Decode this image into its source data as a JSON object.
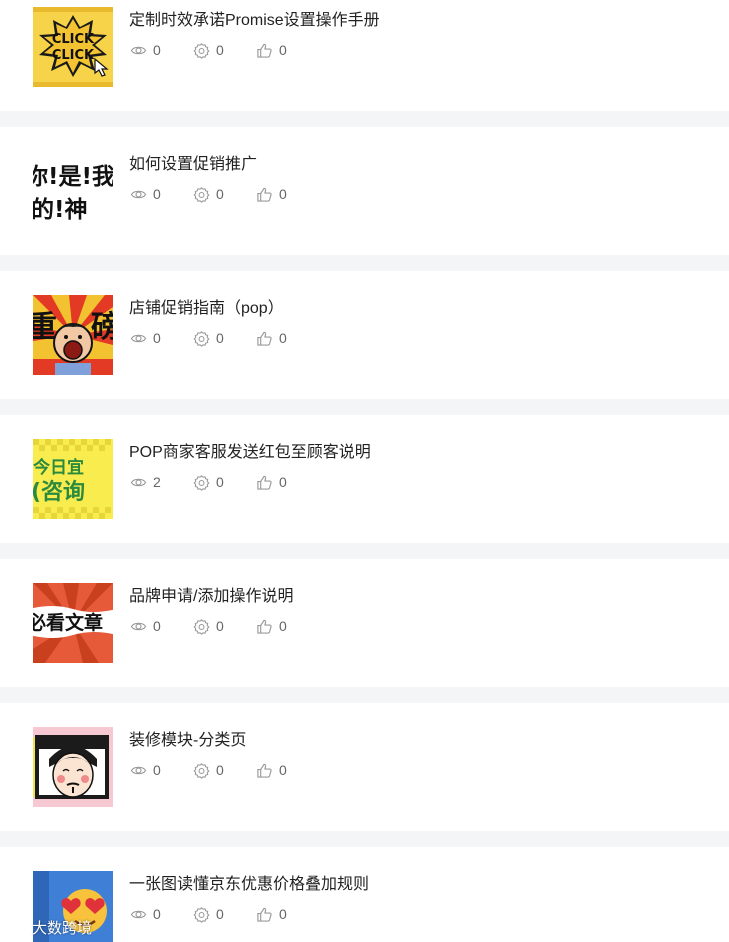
{
  "articles": [
    {
      "title": "定制时效承诺Promise设置操作手册",
      "views": "0",
      "shares": "0",
      "likes": "0",
      "thumb_icon": "click-click-comic-icon",
      "thumb_text": [
        "CLICK",
        "CLICK"
      ]
    },
    {
      "title": "如何设置促销推广",
      "views": "0",
      "shares": "0",
      "likes": "0",
      "thumb_icon": "comic-text-icon",
      "thumb_text": [
        "你!是!我",
        "的!神"
      ]
    },
    {
      "title": "店铺促销指南（pop）",
      "views": "0",
      "shares": "0",
      "likes": "0",
      "thumb_icon": "screaming-cartoon-icon",
      "thumb_text": [
        "重",
        "磅"
      ]
    },
    {
      "title": "POP商家客服发送红包至顾客说明",
      "views": "2",
      "shares": "0",
      "likes": "0",
      "thumb_icon": "today-consult-icon",
      "thumb_text": [
        "今日宜",
        "(咨询"
      ]
    },
    {
      "title": "品牌申请/添加操作说明",
      "views": "0",
      "shares": "0",
      "likes": "0",
      "thumb_icon": "must-read-article-icon",
      "thumb_text": [
        "必看文章"
      ]
    },
    {
      "title": "装修模块-分类页",
      "views": "0",
      "shares": "0",
      "likes": "0",
      "thumb_icon": "cartoon-face-icon",
      "thumb_text": []
    },
    {
      "title": "一张图读懂京东优惠价格叠加规则",
      "views": "0",
      "shares": "0",
      "likes": "0",
      "thumb_icon": "heart-emoji-icon",
      "thumb_text": []
    }
  ],
  "watermark": {
    "text": "大数跨境"
  },
  "icons": {
    "views": "eye-icon",
    "shares": "gear-icon",
    "likes": "thumbs-up-icon"
  },
  "colors": {
    "background": "#f3f5f7",
    "card": "#ffffff",
    "title": "#222222",
    "meta": "#666666",
    "icon": "#999999"
  }
}
